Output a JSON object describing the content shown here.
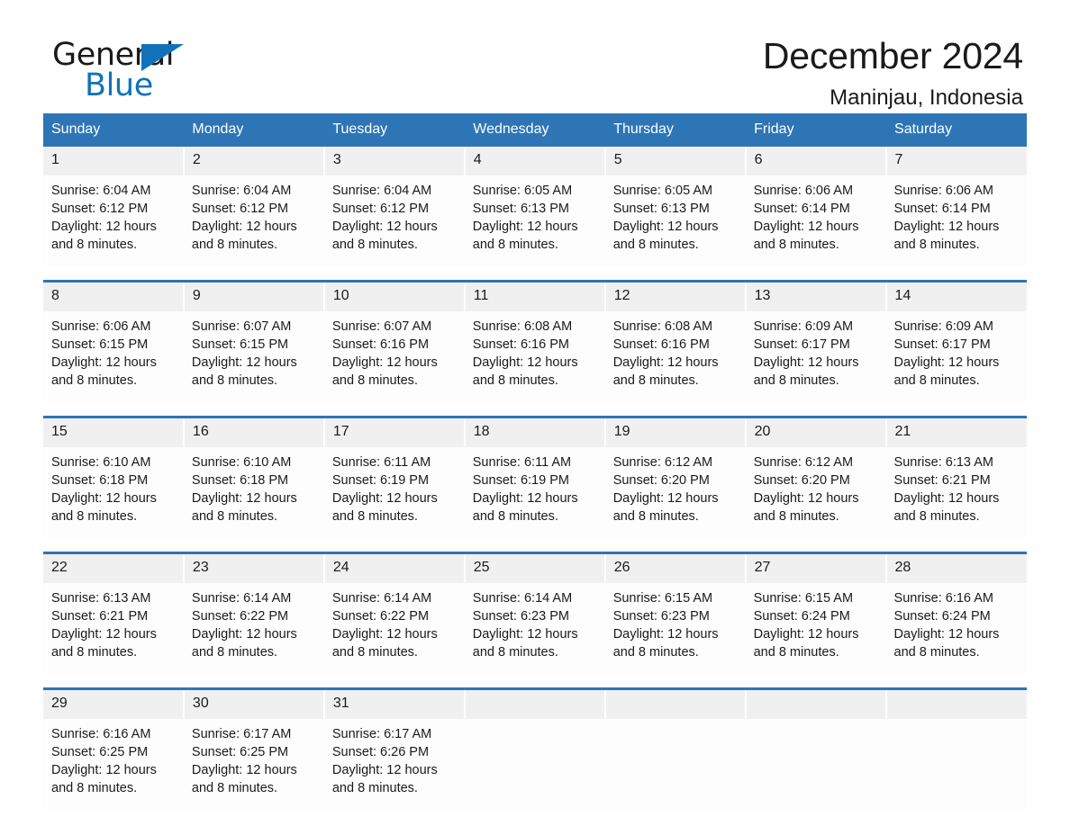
{
  "brand": {
    "name_part1": "General",
    "name_part2": "Blue",
    "triangle_color": "#1172ba",
    "logo_icon": "triangle-icon"
  },
  "header": {
    "title": "December 2024",
    "location": "Maninjau, Indonesia"
  },
  "theme": {
    "header_blue": "#2e75b6",
    "daynum_band": "#f0f0f0",
    "cell_background": "#fdfdfd",
    "text": "#1a1a1a"
  },
  "calendar": {
    "weekday_headers": [
      "Sunday",
      "Monday",
      "Tuesday",
      "Wednesday",
      "Thursday",
      "Friday",
      "Saturday"
    ],
    "weeks": [
      [
        {
          "day": "1",
          "sunrise": "Sunrise: 6:04 AM",
          "sunset": "Sunset: 6:12 PM",
          "daylight_l1": "Daylight: 12 hours",
          "daylight_l2": "and 8 minutes."
        },
        {
          "day": "2",
          "sunrise": "Sunrise: 6:04 AM",
          "sunset": "Sunset: 6:12 PM",
          "daylight_l1": "Daylight: 12 hours",
          "daylight_l2": "and 8 minutes."
        },
        {
          "day": "3",
          "sunrise": "Sunrise: 6:04 AM",
          "sunset": "Sunset: 6:12 PM",
          "daylight_l1": "Daylight: 12 hours",
          "daylight_l2": "and 8 minutes."
        },
        {
          "day": "4",
          "sunrise": "Sunrise: 6:05 AM",
          "sunset": "Sunset: 6:13 PM",
          "daylight_l1": "Daylight: 12 hours",
          "daylight_l2": "and 8 minutes."
        },
        {
          "day": "5",
          "sunrise": "Sunrise: 6:05 AM",
          "sunset": "Sunset: 6:13 PM",
          "daylight_l1": "Daylight: 12 hours",
          "daylight_l2": "and 8 minutes."
        },
        {
          "day": "6",
          "sunrise": "Sunrise: 6:06 AM",
          "sunset": "Sunset: 6:14 PM",
          "daylight_l1": "Daylight: 12 hours",
          "daylight_l2": "and 8 minutes."
        },
        {
          "day": "7",
          "sunrise": "Sunrise: 6:06 AM",
          "sunset": "Sunset: 6:14 PM",
          "daylight_l1": "Daylight: 12 hours",
          "daylight_l2": "and 8 minutes."
        }
      ],
      [
        {
          "day": "8",
          "sunrise": "Sunrise: 6:06 AM",
          "sunset": "Sunset: 6:15 PM",
          "daylight_l1": "Daylight: 12 hours",
          "daylight_l2": "and 8 minutes."
        },
        {
          "day": "9",
          "sunrise": "Sunrise: 6:07 AM",
          "sunset": "Sunset: 6:15 PM",
          "daylight_l1": "Daylight: 12 hours",
          "daylight_l2": "and 8 minutes."
        },
        {
          "day": "10",
          "sunrise": "Sunrise: 6:07 AM",
          "sunset": "Sunset: 6:16 PM",
          "daylight_l1": "Daylight: 12 hours",
          "daylight_l2": "and 8 minutes."
        },
        {
          "day": "11",
          "sunrise": "Sunrise: 6:08 AM",
          "sunset": "Sunset: 6:16 PM",
          "daylight_l1": "Daylight: 12 hours",
          "daylight_l2": "and 8 minutes."
        },
        {
          "day": "12",
          "sunrise": "Sunrise: 6:08 AM",
          "sunset": "Sunset: 6:16 PM",
          "daylight_l1": "Daylight: 12 hours",
          "daylight_l2": "and 8 minutes."
        },
        {
          "day": "13",
          "sunrise": "Sunrise: 6:09 AM",
          "sunset": "Sunset: 6:17 PM",
          "daylight_l1": "Daylight: 12 hours",
          "daylight_l2": "and 8 minutes."
        },
        {
          "day": "14",
          "sunrise": "Sunrise: 6:09 AM",
          "sunset": "Sunset: 6:17 PM",
          "daylight_l1": "Daylight: 12 hours",
          "daylight_l2": "and 8 minutes."
        }
      ],
      [
        {
          "day": "15",
          "sunrise": "Sunrise: 6:10 AM",
          "sunset": "Sunset: 6:18 PM",
          "daylight_l1": "Daylight: 12 hours",
          "daylight_l2": "and 8 minutes."
        },
        {
          "day": "16",
          "sunrise": "Sunrise: 6:10 AM",
          "sunset": "Sunset: 6:18 PM",
          "daylight_l1": "Daylight: 12 hours",
          "daylight_l2": "and 8 minutes."
        },
        {
          "day": "17",
          "sunrise": "Sunrise: 6:11 AM",
          "sunset": "Sunset: 6:19 PM",
          "daylight_l1": "Daylight: 12 hours",
          "daylight_l2": "and 8 minutes."
        },
        {
          "day": "18",
          "sunrise": "Sunrise: 6:11 AM",
          "sunset": "Sunset: 6:19 PM",
          "daylight_l1": "Daylight: 12 hours",
          "daylight_l2": "and 8 minutes."
        },
        {
          "day": "19",
          "sunrise": "Sunrise: 6:12 AM",
          "sunset": "Sunset: 6:20 PM",
          "daylight_l1": "Daylight: 12 hours",
          "daylight_l2": "and 8 minutes."
        },
        {
          "day": "20",
          "sunrise": "Sunrise: 6:12 AM",
          "sunset": "Sunset: 6:20 PM",
          "daylight_l1": "Daylight: 12 hours",
          "daylight_l2": "and 8 minutes."
        },
        {
          "day": "21",
          "sunrise": "Sunrise: 6:13 AM",
          "sunset": "Sunset: 6:21 PM",
          "daylight_l1": "Daylight: 12 hours",
          "daylight_l2": "and 8 minutes."
        }
      ],
      [
        {
          "day": "22",
          "sunrise": "Sunrise: 6:13 AM",
          "sunset": "Sunset: 6:21 PM",
          "daylight_l1": "Daylight: 12 hours",
          "daylight_l2": "and 8 minutes."
        },
        {
          "day": "23",
          "sunrise": "Sunrise: 6:14 AM",
          "sunset": "Sunset: 6:22 PM",
          "daylight_l1": "Daylight: 12 hours",
          "daylight_l2": "and 8 minutes."
        },
        {
          "day": "24",
          "sunrise": "Sunrise: 6:14 AM",
          "sunset": "Sunset: 6:22 PM",
          "daylight_l1": "Daylight: 12 hours",
          "daylight_l2": "and 8 minutes."
        },
        {
          "day": "25",
          "sunrise": "Sunrise: 6:14 AM",
          "sunset": "Sunset: 6:23 PM",
          "daylight_l1": "Daylight: 12 hours",
          "daylight_l2": "and 8 minutes."
        },
        {
          "day": "26",
          "sunrise": "Sunrise: 6:15 AM",
          "sunset": "Sunset: 6:23 PM",
          "daylight_l1": "Daylight: 12 hours",
          "daylight_l2": "and 8 minutes."
        },
        {
          "day": "27",
          "sunrise": "Sunrise: 6:15 AM",
          "sunset": "Sunset: 6:24 PM",
          "daylight_l1": "Daylight: 12 hours",
          "daylight_l2": "and 8 minutes."
        },
        {
          "day": "28",
          "sunrise": "Sunrise: 6:16 AM",
          "sunset": "Sunset: 6:24 PM",
          "daylight_l1": "Daylight: 12 hours",
          "daylight_l2": "and 8 minutes."
        }
      ],
      [
        {
          "day": "29",
          "sunrise": "Sunrise: 6:16 AM",
          "sunset": "Sunset: 6:25 PM",
          "daylight_l1": "Daylight: 12 hours",
          "daylight_l2": "and 8 minutes."
        },
        {
          "day": "30",
          "sunrise": "Sunrise: 6:17 AM",
          "sunset": "Sunset: 6:25 PM",
          "daylight_l1": "Daylight: 12 hours",
          "daylight_l2": "and 8 minutes."
        },
        {
          "day": "31",
          "sunrise": "Sunrise: 6:17 AM",
          "sunset": "Sunset: 6:26 PM",
          "daylight_l1": "Daylight: 12 hours",
          "daylight_l2": "and 8 minutes."
        },
        {
          "day": "",
          "sunrise": "",
          "sunset": "",
          "daylight_l1": "",
          "daylight_l2": ""
        },
        {
          "day": "",
          "sunrise": "",
          "sunset": "",
          "daylight_l1": "",
          "daylight_l2": ""
        },
        {
          "day": "",
          "sunrise": "",
          "sunset": "",
          "daylight_l1": "",
          "daylight_l2": ""
        },
        {
          "day": "",
          "sunrise": "",
          "sunset": "",
          "daylight_l1": "",
          "daylight_l2": ""
        }
      ]
    ]
  }
}
